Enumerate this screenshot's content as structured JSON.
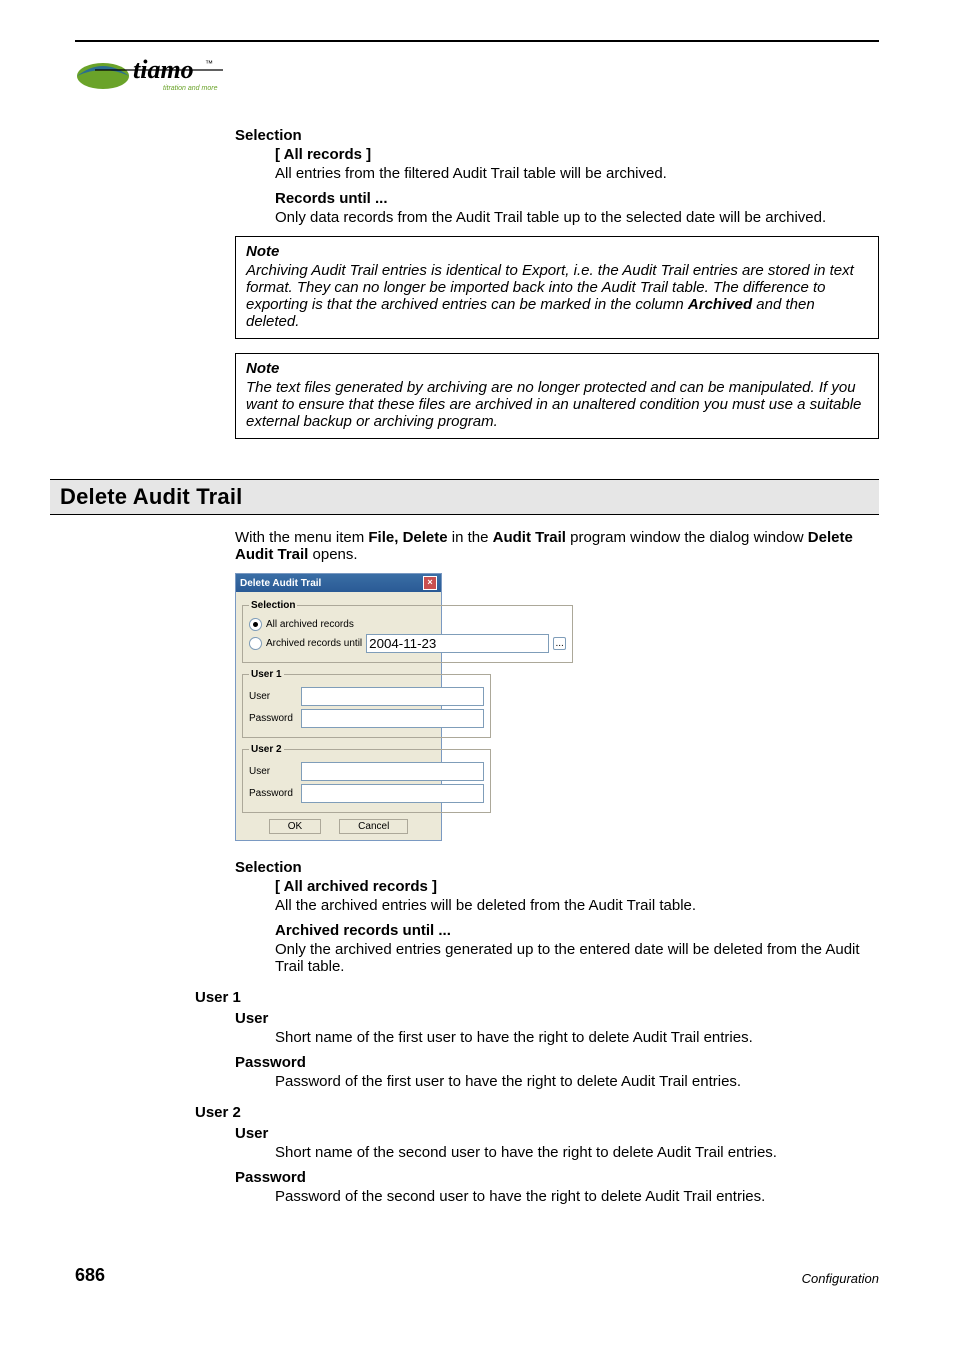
{
  "logo": {
    "brand": "tiamo",
    "tagline": "titration and more"
  },
  "selection1": {
    "heading": "Selection",
    "opt1_title": "[ All records ]",
    "opt1_desc": "All entries from the filtered Audit Trail table will be archived.",
    "opt2_title": "Records until ...",
    "opt2_desc": "Only data records from the Audit Trail table up to the selected date will be archived."
  },
  "note1": {
    "title": "Note",
    "body_a": "Archiving Audit Trail entries is identical to Export, i.e. the Audit Trail entries are stored in text format. They can no longer be imported back into the Audit Trail table. The difference to exporting is that the archived entries can be marked in the column ",
    "body_b": "Archived",
    "body_c": " and then deleted."
  },
  "note2": {
    "title": "Note",
    "body": "The text files generated by archiving are no longer protected and can be manipulated. If you want to ensure that these files are archived in an unaltered condition you must use a suitable external backup or archiving program."
  },
  "section": {
    "title": "Delete Audit Trail"
  },
  "intro": {
    "a": "With the menu item ",
    "b": "File, Delete",
    "c": " in the ",
    "d": "Audit Trail",
    "e": " program window the dialog window ",
    "f": "Delete Audit Trail",
    "g": " opens."
  },
  "dialog": {
    "title": "Delete Audit Trail",
    "selection": "Selection",
    "radio1": "All archived records",
    "radio2": "Archived records until",
    "date": "2004-11-23",
    "ellipsis": "...",
    "user1_legend": "User 1",
    "user2_legend": "User 2",
    "user_lbl": "User",
    "pwd_lbl": "Password",
    "ok": "OK",
    "cancel": "Cancel"
  },
  "selection2": {
    "heading": "Selection",
    "opt1_title": "[ All archived records ]",
    "opt1_desc": "All the archived entries will be deleted from the Audit Trail table.",
    "opt2_title": "Archived records until ...",
    "opt2_desc": "Only the archived entries generated up to the entered date will be deleted from the Audit Trail table."
  },
  "user1": {
    "heading": "User 1",
    "user_t": "User",
    "user_d": "Short name of the first user to have the right to delete Audit Trail entries.",
    "pwd_t": "Password",
    "pwd_d": "Password of the first user to have the right to delete Audit Trail entries."
  },
  "user2": {
    "heading": "User 2",
    "user_t": "User",
    "user_d": "Short name of the second user to have the right to delete Audit Trail entries.",
    "pwd_t": "Password",
    "pwd_d": "Password of the second user to have the right to delete Audit Trail entries."
  },
  "footer": {
    "page": "686",
    "section": "Configuration"
  }
}
